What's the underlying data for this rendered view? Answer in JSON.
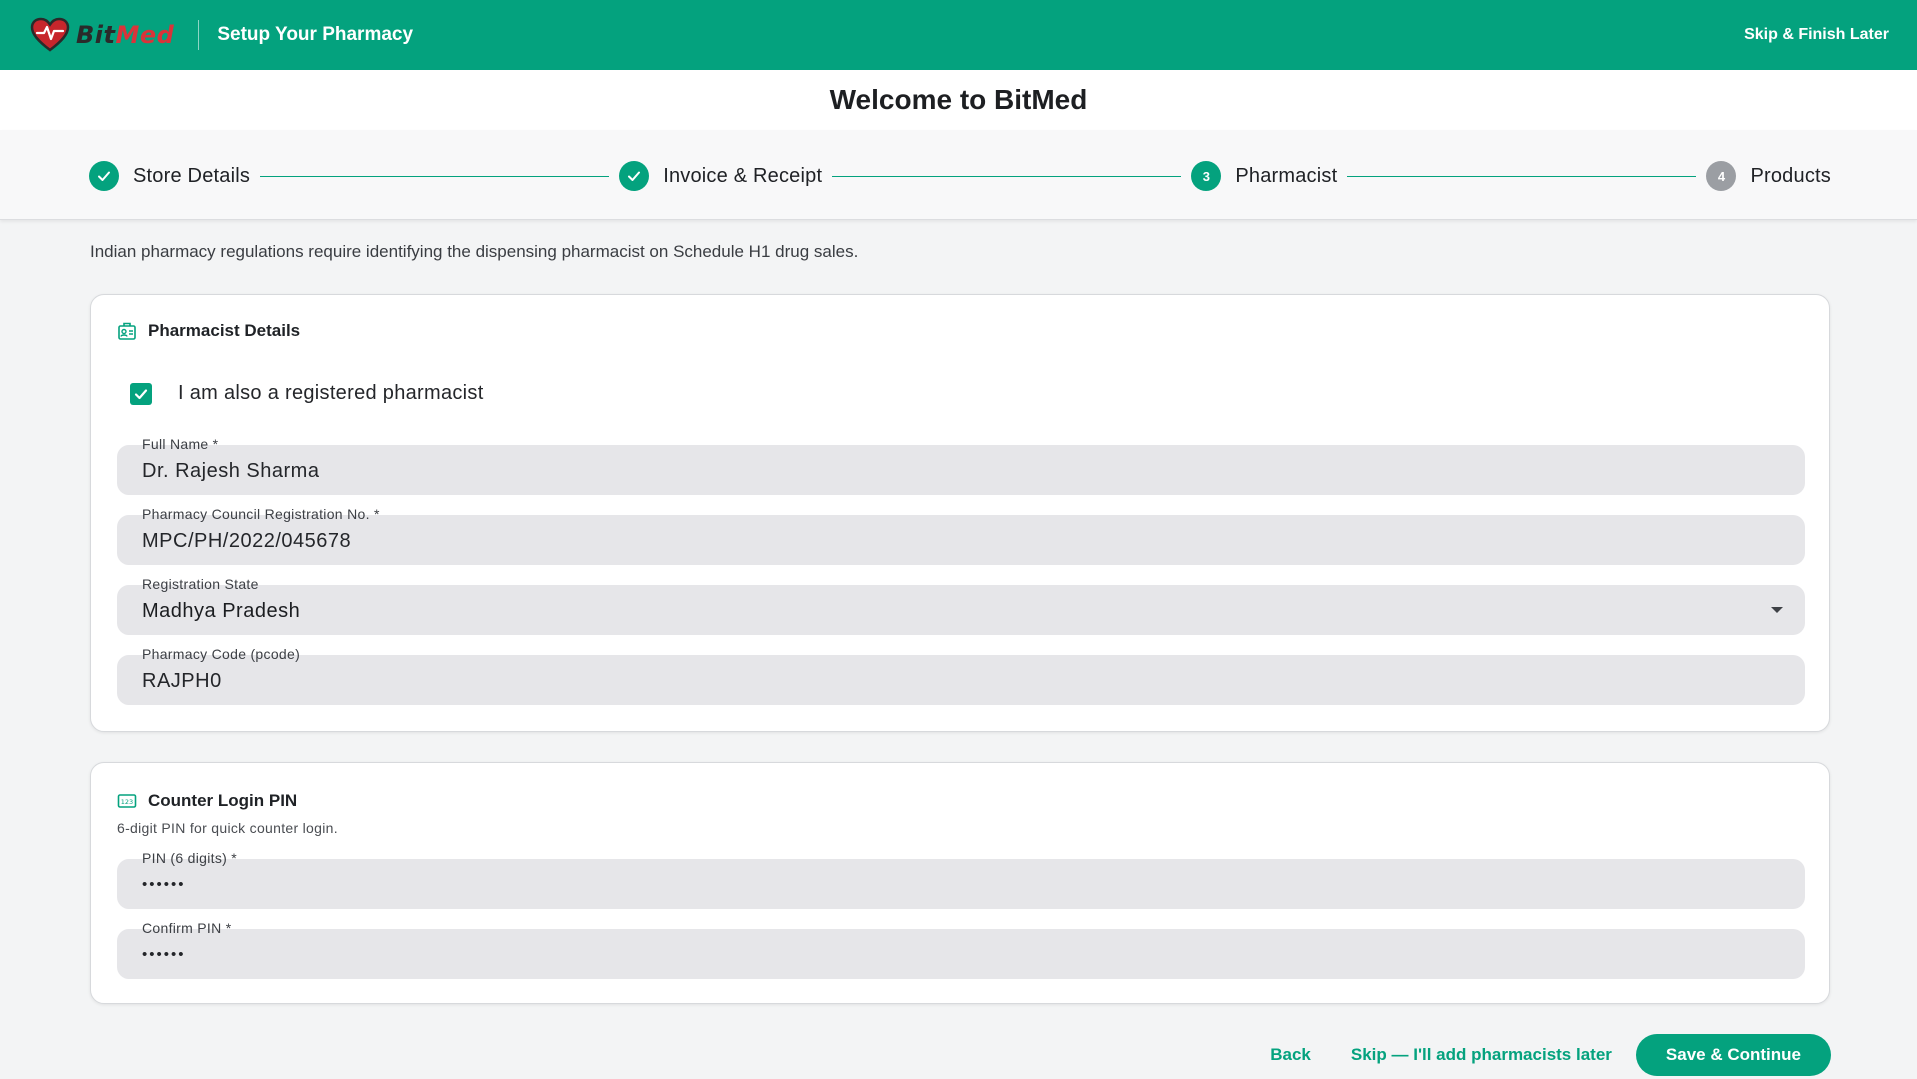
{
  "app": {
    "logo_part1": "Bit",
    "logo_part2": "Med",
    "header_title": "Setup Your Pharmacy",
    "skip_finish": "Skip & Finish Later"
  },
  "welcome": "Welcome to BitMed",
  "steps": [
    {
      "label": "Store Details",
      "state": "done",
      "number": ""
    },
    {
      "label": "Invoice & Receipt",
      "state": "done",
      "number": ""
    },
    {
      "label": "Pharmacist",
      "state": "active",
      "number": "3"
    },
    {
      "label": "Products",
      "state": "pending",
      "number": "4"
    }
  ],
  "intro": "Indian pharmacy regulations require identifying the dispensing pharmacist on Schedule H1 drug sales.",
  "pharmacist_card": {
    "title": "Pharmacist Details",
    "icon": "id-badge-icon",
    "checkbox_label": "I am also a registered pharmacist",
    "checkbox_checked": true,
    "fields": {
      "full_name": {
        "label": "Full Name *",
        "value": "Dr. Rajesh Sharma"
      },
      "registration_no": {
        "label": "Pharmacy Council Registration No. *",
        "value": "MPC/PH/2022/045678"
      },
      "registration_state": {
        "label": "Registration State",
        "value": "Madhya Pradesh"
      },
      "pharmacy_code": {
        "label": "Pharmacy Code (pcode)",
        "value": "RAJPH0"
      }
    }
  },
  "pin_card": {
    "title": "Counter Login PIN",
    "icon": "numeric-keypad-icon",
    "subtitle": "6-digit PIN for quick counter login.",
    "fields": {
      "pin": {
        "label": "PIN (6 digits) *",
        "value": "••••••"
      },
      "confirm_pin": {
        "label": "Confirm PIN *",
        "value": "••••••"
      }
    }
  },
  "actions": {
    "back": "Back",
    "skip": "Skip — I'll add pharmacists later",
    "save": "Save & Continue"
  },
  "colors": {
    "primary": "#04a27e",
    "logo_red": "#d9343a",
    "pending_step": "#9b9ea3",
    "field_bg": "#e6e6e9"
  }
}
